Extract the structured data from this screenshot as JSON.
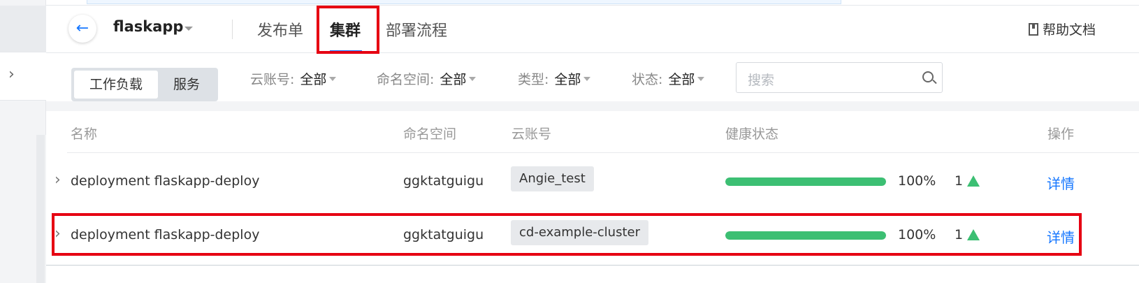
{
  "header": {
    "app_name": "flaskapp",
    "tabs": [
      {
        "label": "发布单"
      },
      {
        "label": "集群"
      },
      {
        "label": "部署流程"
      }
    ],
    "help_label": "帮助文档"
  },
  "filters": {
    "segment": {
      "workload": "工作负载",
      "service": "服务"
    },
    "cloud_account": {
      "key": "云账号:",
      "value": "全部"
    },
    "namespace": {
      "key": "命名空间:",
      "value": "全部"
    },
    "type": {
      "key": "类型:",
      "value": "全部"
    },
    "status": {
      "key": "状态:",
      "value": "全部"
    },
    "search_placeholder": "搜索"
  },
  "table": {
    "columns": [
      "名称",
      "命名空间",
      "云账号",
      "健康状态",
      "操作"
    ],
    "rows": [
      {
        "name": "deployment flaskapp-deploy",
        "namespace": "ggktatguigu",
        "account": "Angie_test",
        "health_pct": "100%",
        "health_fill": 1.0,
        "count": "1",
        "action": "详情"
      },
      {
        "name": "deployment flaskapp-deploy",
        "namespace": "ggktatguigu",
        "account": "cd-example-cluster",
        "health_pct": "100%",
        "health_fill": 1.0,
        "count": "1",
        "action": "详情"
      }
    ]
  },
  "colors": {
    "accent": "#1677ff",
    "healthy": "#3cbf73",
    "highlight": "#e60012"
  }
}
